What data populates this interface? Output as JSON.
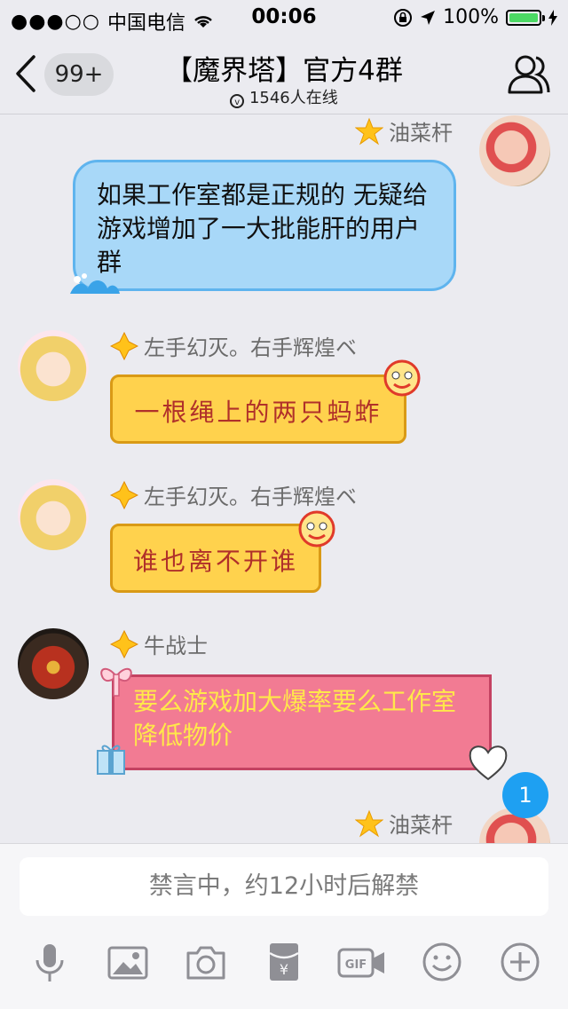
{
  "status": {
    "carrier": "中国电信",
    "time": "00:06",
    "battery": "100%"
  },
  "nav": {
    "badge": "99+",
    "title": "【魔界塔】官方4群",
    "online": "1546人在线"
  },
  "messages": [
    {
      "sender": "油菜杆",
      "text": "如果工作室都是正规的 无疑给游戏增加了一大批能肝的用户群"
    },
    {
      "sender": "左手幻灭。右手辉煌ベ",
      "text": "一根绳上的两只蚂蚱"
    },
    {
      "sender": "左手幻灭。右手辉煌ベ",
      "text": "谁也离不开谁"
    },
    {
      "sender": "牛战士",
      "text": "要么游戏加大爆率要么工作室降低物价"
    },
    {
      "sender": "油菜杆"
    }
  ],
  "unread_count": "1",
  "input": {
    "mute_text": "禁言中，约12小时后解禁"
  },
  "toolbar": {
    "icons": [
      "microphone-icon",
      "image-icon",
      "camera-icon",
      "red-envelope-icon",
      "gif-icon",
      "emoji-icon",
      "plus-icon"
    ]
  },
  "colors": {
    "accent": "#1ea0f2",
    "blue_bubble": "#a8d8f8",
    "yellow_bubble": "#ffd24d",
    "pink_bubble": "#f27b93"
  }
}
